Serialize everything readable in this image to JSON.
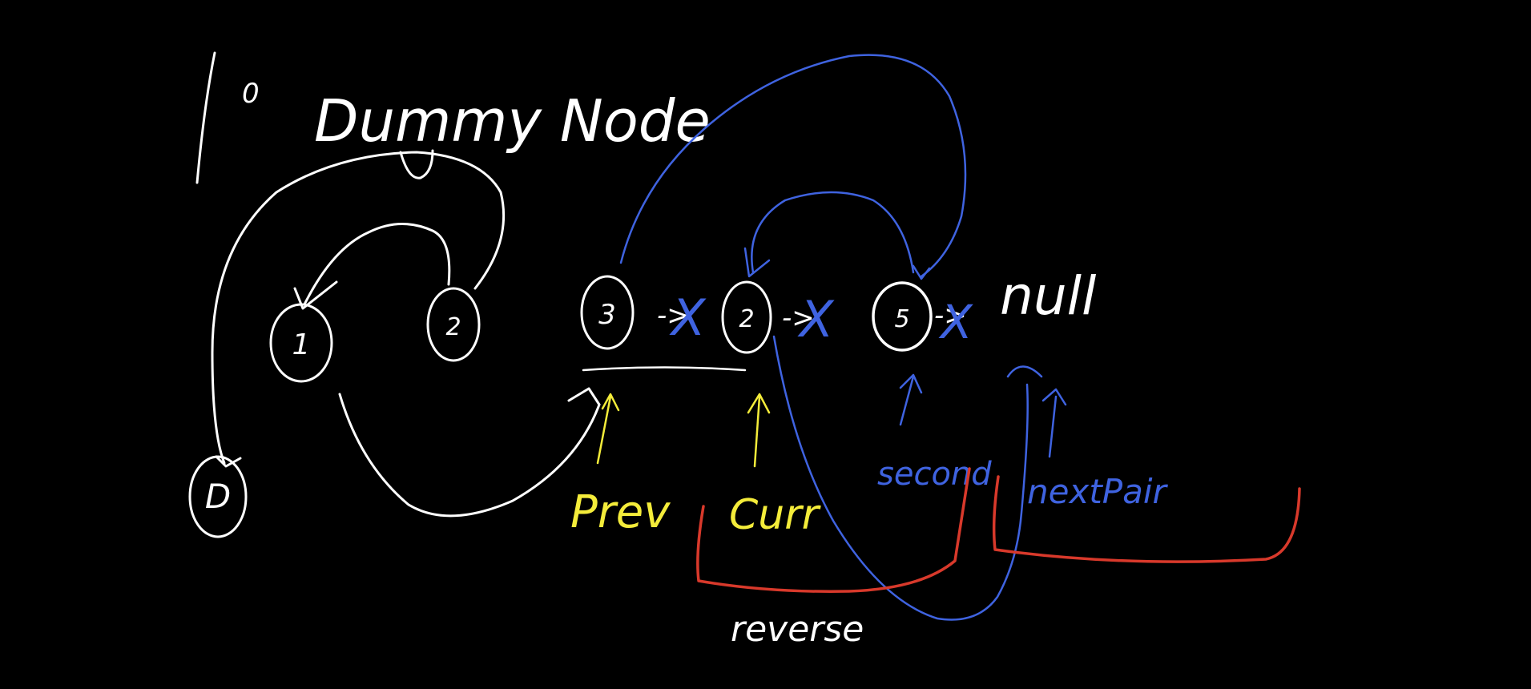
{
  "colors": {
    "background": "#000000",
    "white_ink": "#ffffff",
    "blue_ink": "#3f63e0",
    "yellow_ink": "#f4ec3a",
    "red_ink": "#d8392b"
  },
  "labels": {
    "heading_num": "1",
    "heading_deg": "0",
    "heading_text": "Dummy Node",
    "node_dummy": "D",
    "node_1": "1",
    "node_2_left": "2",
    "node_3": "3",
    "node_2_mid": "2",
    "node_5": "5",
    "arrow_1": "->",
    "arrow_2": "->",
    "arrow_3": "->",
    "null_text": "null",
    "prev_label": "Prev",
    "curr_label": "Curr",
    "second_label": "second",
    "next_pair_label": "nextPair",
    "reverse_label": "reverse",
    "cross_mark": "X"
  }
}
